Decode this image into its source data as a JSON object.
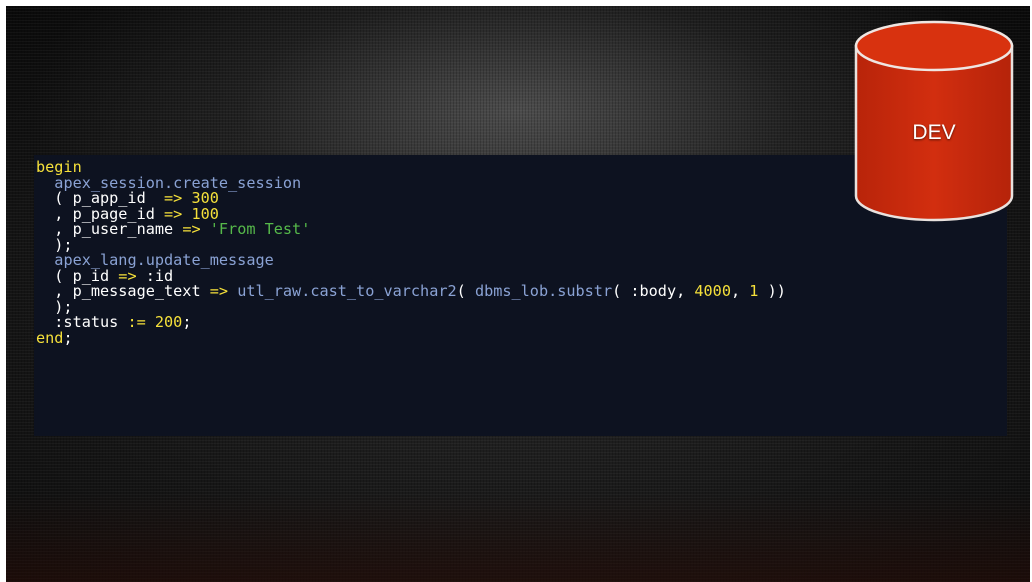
{
  "code": {
    "lines": [
      [
        {
          "t": "begin",
          "c": "kw"
        }
      ],
      [
        {
          "t": "  "
        },
        {
          "t": "apex_session.create_session",
          "c": "fn"
        }
      ],
      [
        {
          "t": "  ( p_app_id  "
        },
        {
          "t": "=>",
          "c": "op"
        },
        {
          "t": " "
        },
        {
          "t": "300",
          "c": "num"
        }
      ],
      [
        {
          "t": "  , p_page_id "
        },
        {
          "t": "=>",
          "c": "op"
        },
        {
          "t": " "
        },
        {
          "t": "100",
          "c": "num"
        }
      ],
      [
        {
          "t": "  , p_user_name "
        },
        {
          "t": "=>",
          "c": "op"
        },
        {
          "t": " "
        },
        {
          "t": "'From Test'",
          "c": "str"
        }
      ],
      [
        {
          "t": "  );"
        }
      ],
      [
        {
          "t": "  "
        },
        {
          "t": "apex_lang.update_message",
          "c": "fn"
        }
      ],
      [
        {
          "t": "  ( p_id "
        },
        {
          "t": "=>",
          "c": "op"
        },
        {
          "t": " :id"
        }
      ],
      [
        {
          "t": "  , p_message_text "
        },
        {
          "t": "=>",
          "c": "op"
        },
        {
          "t": " "
        },
        {
          "t": "utl_raw.cast_to_varchar2",
          "c": "fn"
        },
        {
          "t": "( "
        },
        {
          "t": "dbms_lob.substr",
          "c": "fn"
        },
        {
          "t": "( :body, "
        },
        {
          "t": "4000",
          "c": "num"
        },
        {
          "t": ", "
        },
        {
          "t": "1",
          "c": "num"
        },
        {
          "t": " ))"
        }
      ],
      [
        {
          "t": "  );"
        }
      ],
      [
        {
          "t": "  :status "
        },
        {
          "t": ":=",
          "c": "op"
        },
        {
          "t": " "
        },
        {
          "t": "200",
          "c": "num"
        },
        {
          "t": ";"
        }
      ],
      [
        {
          "t": "end",
          "c": "kw"
        },
        {
          "t": ";"
        }
      ]
    ]
  },
  "database": {
    "label": "DEV",
    "color": "#cc2a0c",
    "icon": "database-cylinder-icon"
  },
  "colors": {
    "keyword": "#f5e03a",
    "string": "#56b94a",
    "function": "#8aa2d4",
    "panel": "#0d1220"
  }
}
